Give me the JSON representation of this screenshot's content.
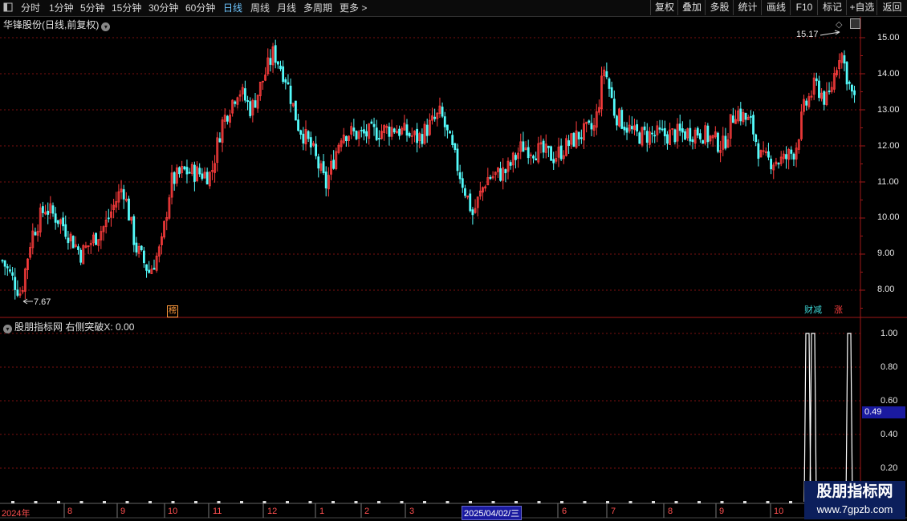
{
  "toolbar": {
    "periods": [
      "分时",
      "1分钟",
      "5分钟",
      "15分钟",
      "30分钟",
      "60分钟",
      "日线",
      "周线",
      "月线",
      "多周期",
      "更多 >"
    ],
    "active_period": "日线",
    "buttons": [
      "复权",
      "叠加",
      "多股",
      "统计",
      "画线",
      "F10",
      "标记",
      "+自选",
      "返回"
    ]
  },
  "main_panel": {
    "title": "华锋股份(日线,前复权)",
    "high_marker": "15.17",
    "low_marker": "7.67",
    "y_ticks": [
      "15.00",
      "14.00",
      "13.00",
      "12.00",
      "11.00",
      "10.00",
      "9.00",
      "8.00"
    ],
    "tags": [
      {
        "text": "榜",
        "color": "#ff9a3c"
      },
      {
        "text": "财减",
        "color": "#3dd6d6"
      },
      {
        "text": "涨",
        "color": "#ff4040"
      }
    ]
  },
  "sub_panel": {
    "title": "股朋指标网 右侧突破X: 0.00",
    "y_ticks": [
      "1.00",
      "0.80",
      "0.60",
      "0.40",
      "0.20"
    ],
    "current_value": "0.49"
  },
  "x_axis": {
    "labels": [
      "2024年",
      "8",
      "9",
      "10",
      "11",
      "12",
      "1",
      "2",
      "3",
      "2025/04/02/三",
      "6",
      "7",
      "8",
      "9",
      "10"
    ],
    "highlight": "2025/04/02/三"
  },
  "watermark": {
    "line1": "股朋指标网",
    "line2": "www.7gpzb.com"
  },
  "colors": {
    "up": "#ff3d3d",
    "down": "#54fcfc",
    "grid": "#7a1010",
    "axis": "#a01818",
    "accent": "#6ec6ff"
  },
  "chart_data": {
    "type": "candlestick",
    "title": "华锋股份(日线,前复权)",
    "ylim": [
      7.5,
      15.3
    ],
    "period": "daily",
    "date_range": [
      "2024-07",
      "2025-10"
    ],
    "max": 15.17,
    "min": 7.67,
    "trend": [
      {
        "x": 0,
        "y": 8.9
      },
      {
        "x": 10,
        "y": 8.5
      },
      {
        "x": 25,
        "y": 7.9
      },
      {
        "x": 38,
        "y": 9.5
      },
      {
        "x": 55,
        "y": 10.3
      },
      {
        "x": 75,
        "y": 9.9
      },
      {
        "x": 100,
        "y": 9.0
      },
      {
        "x": 130,
        "y": 9.8
      },
      {
        "x": 152,
        "y": 10.9
      },
      {
        "x": 168,
        "y": 9.2
      },
      {
        "x": 185,
        "y": 8.5
      },
      {
        "x": 200,
        "y": 9.2
      },
      {
        "x": 212,
        "y": 11.0
      },
      {
        "x": 228,
        "y": 11.3
      },
      {
        "x": 262,
        "y": 11.2
      },
      {
        "x": 275,
        "y": 12.6
      },
      {
        "x": 296,
        "y": 13.6
      },
      {
        "x": 312,
        "y": 13.0
      },
      {
        "x": 340,
        "y": 14.6
      },
      {
        "x": 355,
        "y": 13.9
      },
      {
        "x": 370,
        "y": 12.6
      },
      {
        "x": 388,
        "y": 11.9
      },
      {
        "x": 405,
        "y": 10.9
      },
      {
        "x": 425,
        "y": 12.4
      },
      {
        "x": 450,
        "y": 12.3
      },
      {
        "x": 490,
        "y": 12.5
      },
      {
        "x": 520,
        "y": 12.2
      },
      {
        "x": 548,
        "y": 12.9
      },
      {
        "x": 568,
        "y": 11.5
      },
      {
        "x": 588,
        "y": 10.1
      },
      {
        "x": 605,
        "y": 11.1
      },
      {
        "x": 630,
        "y": 11.3
      },
      {
        "x": 650,
        "y": 12.0
      },
      {
        "x": 690,
        "y": 11.7
      },
      {
        "x": 720,
        "y": 12.3
      },
      {
        "x": 740,
        "y": 12.5
      },
      {
        "x": 752,
        "y": 14.2
      },
      {
        "x": 765,
        "y": 12.9
      },
      {
        "x": 790,
        "y": 12.3
      },
      {
        "x": 830,
        "y": 12.3
      },
      {
        "x": 870,
        "y": 12.4
      },
      {
        "x": 900,
        "y": 12.0
      },
      {
        "x": 915,
        "y": 13.0
      },
      {
        "x": 935,
        "y": 12.6
      },
      {
        "x": 948,
        "y": 11.6
      },
      {
        "x": 975,
        "y": 11.6
      },
      {
        "x": 990,
        "y": 11.9
      },
      {
        "x": 1000,
        "y": 13.0
      },
      {
        "x": 1015,
        "y": 13.7
      },
      {
        "x": 1030,
        "y": 13.2
      },
      {
        "x": 1046,
        "y": 14.7
      },
      {
        "x": 1058,
        "y": 13.6
      },
      {
        "x": 1064,
        "y": 13.2
      }
    ],
    "signal_series": {
      "name": "右侧突破X",
      "spike_positions": [
        1006,
        1013,
        1058
      ],
      "spike_value": 1.0
    }
  }
}
